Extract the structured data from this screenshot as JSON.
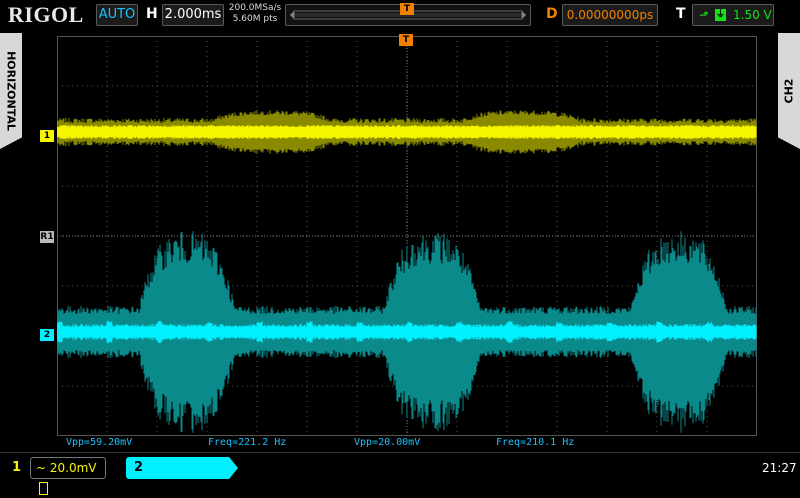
{
  "brand": "RIGOL",
  "header": {
    "mode": "AUTO",
    "h_label": "H",
    "timebase": "2.000ms",
    "sample_rate": "200.0MSa/s",
    "mem_depth": "5.60M pts",
    "d_label": "D",
    "delay": "0.00000000ps",
    "t_label": "T",
    "trigger_level": "1.50 V"
  },
  "side_tabs": {
    "left": "HORIZONTAL",
    "right": "CH2"
  },
  "markers": {
    "ch1": "1",
    "ch2": "2",
    "ref": "R1",
    "trigger": "T"
  },
  "measurements": [
    {
      "text": "Vpp=59.20mV"
    },
    {
      "text": "Freq=221.2 Hz"
    },
    {
      "text": "Vpp=20.00mV"
    },
    {
      "text": "Freq=210.1 Hz"
    }
  ],
  "channels": {
    "ch1": {
      "num": "1",
      "scale": "20.0mV",
      "coupling": "~",
      "color": "#f5f500"
    },
    "ch2": {
      "num": "2",
      "scale": "20.0mV",
      "coupling": "~",
      "color": "#00f0ff"
    }
  },
  "clock": "21:27",
  "colors": {
    "ch1": "#f5f500",
    "ch1_dim": "#8a8a00",
    "ch2": "#00f0ff",
    "ch2_dim": "#0a8a8a",
    "accent": "#f08000",
    "grid": "#555555"
  }
}
